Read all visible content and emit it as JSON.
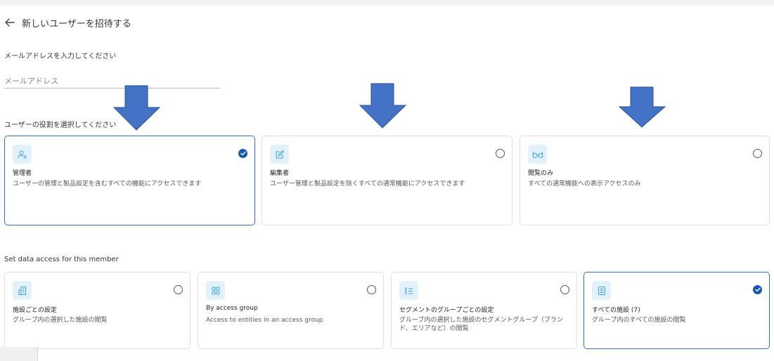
{
  "header": {
    "back_icon": "arrow-left-icon",
    "title": "新しいユーザーを招待する"
  },
  "email": {
    "label": "メールアドレスを入力してください",
    "placeholder": "メールアドレス",
    "value": ""
  },
  "roles": {
    "label": "ユーザーの役割を選択してください",
    "items": [
      {
        "icon": "user-gear-icon",
        "title": "管理者",
        "description": "ユーザーの管理と製品設定を含むすべての機能にアクセスできます",
        "selected": true
      },
      {
        "icon": "edit-icon",
        "title": "編集者",
        "description": "ユーザー管理と製品設定を除くすべての通常機能にアクセスできます",
        "selected": false
      },
      {
        "icon": "glasses-icon",
        "title": "閲覧のみ",
        "description": "すべての通常機能への表示アクセスのみ",
        "selected": false
      }
    ]
  },
  "access": {
    "label": "Set data access for this member",
    "items": [
      {
        "icon": "building-icon",
        "title": "施設ごとの設定",
        "description": "グループ内の選択した施設の閲覧",
        "selected": false
      },
      {
        "icon": "grid-icon",
        "title": "By access group",
        "description": "Access to entities in an access group",
        "selected": false
      },
      {
        "icon": "hierarchy-list-icon",
        "title": "セグメントのグループごとの設定",
        "description": "グループ内の選択した施設のセグメントグループ（ブランド、エリアなど）の閲覧",
        "selected": false
      },
      {
        "icon": "list-icon",
        "title": "すべての施設 (7)",
        "description": "グループ内のすべての施設の閲覧",
        "selected": true
      }
    ]
  },
  "colors": {
    "accent": "#1a57a8",
    "icon_bg": "#e3f1fb",
    "icon_fg": "#3aa0dc",
    "annotation_arrow": "#4472c4"
  }
}
